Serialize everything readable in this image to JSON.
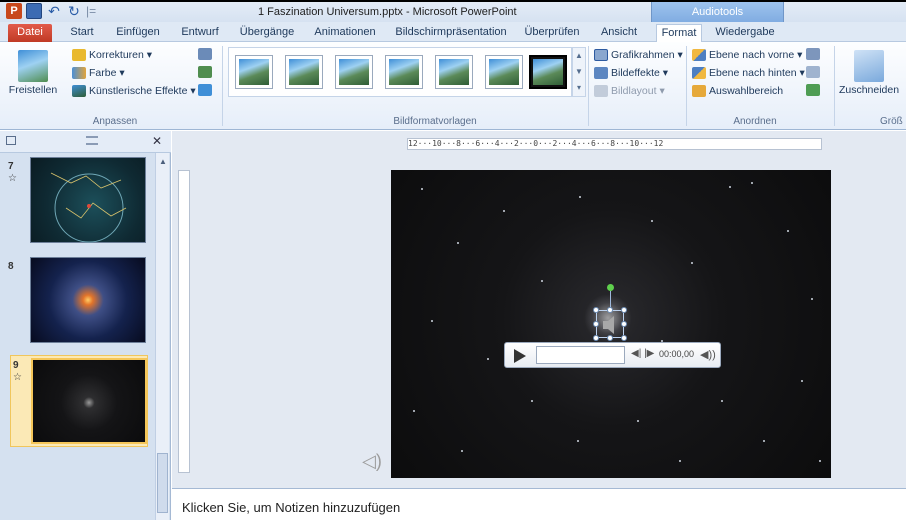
{
  "app": {
    "title": "1 Faszination Universum.pptx - Microsoft PowerPoint",
    "logo_letter": "P",
    "context_tab_header": "Audiotools"
  },
  "qat": {
    "undo": "↶",
    "redo": "↻",
    "customize": "|="
  },
  "tabs": [
    "Datei",
    "Start",
    "Einfügen",
    "Entwurf",
    "Übergänge",
    "Animationen",
    "Bildschirmpräsentation",
    "Überprüfen",
    "Ansicht",
    "Format",
    "Wiedergabe"
  ],
  "active_tab": "Format",
  "ribbon": {
    "adjust": {
      "freistellen": "Freistellen",
      "korrekturen": "Korrekturen ▾",
      "farbe": "Farbe ▾",
      "kuenstlerische": "Künstlerische Effekte ▾",
      "label": "Anpassen"
    },
    "styles": {
      "label": "Bildformatvorlagen"
    },
    "picture_options": {
      "rahmen": "Grafikrahmen ▾",
      "effekte": "Bildeffekte ▾",
      "layout": "Bildlayout ▾"
    },
    "arrange": {
      "vorne": "Ebene nach vorne ▾",
      "hinten": "Ebene nach hinten ▾",
      "auswahl": "Auswahlbereich",
      "label": "Anordnen"
    },
    "size": {
      "zuschneiden": "Zuschneiden",
      "label": "Größ"
    }
  },
  "slides": [
    {
      "number": "7",
      "star": "☆"
    },
    {
      "number": "8",
      "star": ""
    },
    {
      "number": "9",
      "star": "☆"
    }
  ],
  "ruler": {
    "horizontal": "12···10···8···6···4···2···0···2···4···6···8···10···12"
  },
  "player": {
    "time": "00:00,00",
    "skip": "◀| |▶",
    "volume": "◀))"
  },
  "notes": {
    "placeholder": "Klicken Sie, um Notizen hinzuzufügen"
  },
  "colors": {
    "file_tab": "#c03a25",
    "context_tab": "#7eaae0",
    "selection": "#f5c659"
  }
}
